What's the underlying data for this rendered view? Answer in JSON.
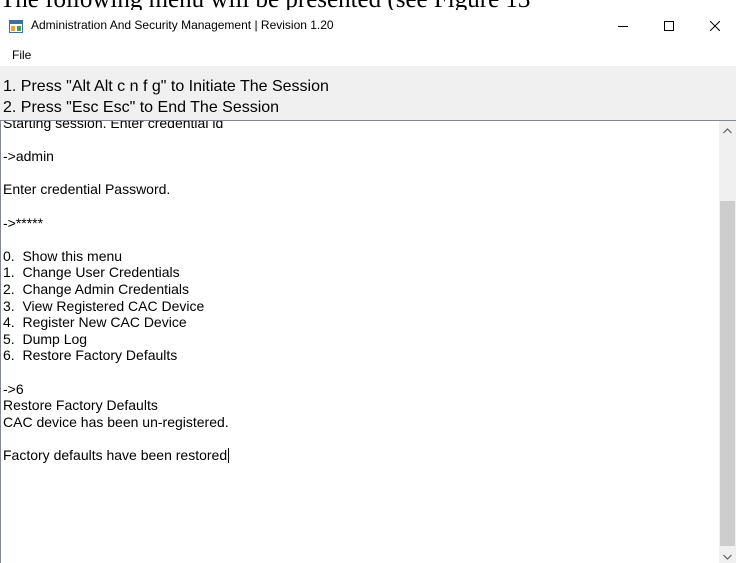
{
  "document": {
    "caption": "The following menu will be presented (see Figure 13"
  },
  "window": {
    "title": "Administration And Security Management  |  Revision 1.20",
    "icon": "app-window-icon",
    "controls": {
      "minimize_icon": "minimize-icon",
      "maximize_icon": "maximize-icon",
      "close_icon": "close-icon"
    }
  },
  "menubar": {
    "items": [
      {
        "label": "File"
      }
    ]
  },
  "instructions": {
    "line1": "1. Press \"Alt Alt c n f g\" to Initiate The Session",
    "line2": "2. Press \"Esc Esc\" to End The Session"
  },
  "console": {
    "text": "Starting session. Enter credential id\n\n->admin\n\nEnter credential Password.\n\n->*****\n\n0.  Show this menu\n1.  Change User Credentials\n2.  Change Admin Credentials\n3.  View Registered CAC Device\n4.  Register New CAC Device\n5.  Dump Log\n6.  Restore Factory Defaults\n\n->6\nRestore Factory Defaults\nCAC device has been un-registered.\n\nFactory defaults have been restored"
  },
  "scrollbar": {
    "up_icon": "scroll-up-arrow-icon",
    "down_icon": "scroll-down-arrow-icon"
  }
}
